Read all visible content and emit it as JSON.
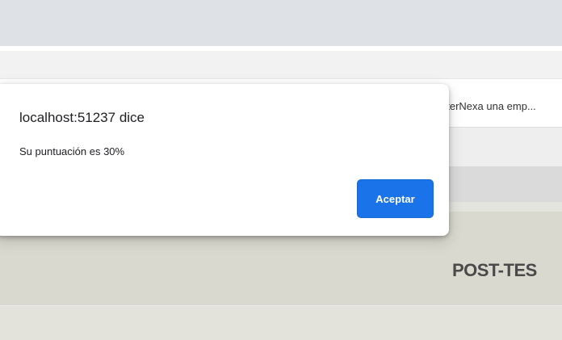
{
  "browser": {
    "page_text_truncated": "nterNexa una emp..."
  },
  "page": {
    "band_title": "POST-TES"
  },
  "alert_dialog": {
    "title": "localhost:51237 dice",
    "message": "Su puntuación es 30%",
    "ok_label": "Aceptar",
    "accent_color": "#1a73e8"
  }
}
